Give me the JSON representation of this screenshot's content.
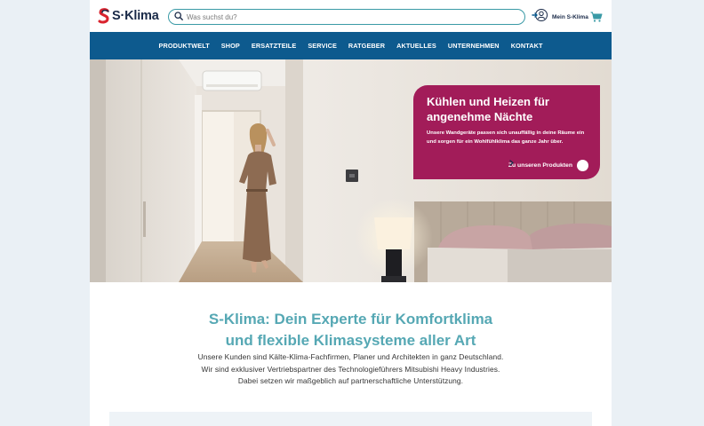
{
  "brand": {
    "name": "S·Klima",
    "accent": "#0d5a8e",
    "logo_red": "#d9232e",
    "logo_teal": "#3a9aa6",
    "promo_color": "#a21c59",
    "heading_color": "#56a8b4"
  },
  "search": {
    "placeholder": "Was suchst du?",
    "icon": "search-icon"
  },
  "account": {
    "label": "Mein S-Klima",
    "icon": "user-icon"
  },
  "cart": {
    "icon": "cart-icon"
  },
  "nav": {
    "items": [
      {
        "label": "PRODUKTWELT"
      },
      {
        "label": "SHOP"
      },
      {
        "label": "ERSATZTEILE"
      },
      {
        "label": "SERVICE"
      },
      {
        "label": "RATGEBER"
      },
      {
        "label": "AKTUELLES"
      },
      {
        "label": "UNTERNEHMEN"
      },
      {
        "label": "KONTAKT"
      }
    ]
  },
  "hero": {
    "promo": {
      "title_line1": "Kühlen und Heizen für",
      "title_line2": "angenehme Nächte",
      "text": "Unsere Wandgeräte passen sich unauffällig in deine Räume ein und sorgen für ein Wohlfühlklima das ganze Jahr über.",
      "link_label": "Zu unseren Produkten",
      "link_icon": "arrow-right-icon"
    }
  },
  "intro": {
    "title_line1": "S-Klima: Dein Experte für Komfortklima",
    "title_line2": "und flexible Klimasysteme aller Art",
    "text_line1": "Unsere Kunden sind Kälte-Klima-Fachfirmen, Planer und Architekten in ganz Deutschland.",
    "text_line2": "Wir sind exklusiver Vertriebspartner des Technologieführers Mitsubishi Heavy Industries.",
    "text_line3": "Dabei setzen wir maßgeblich auf partnerschaftliche Unterstützung."
  }
}
